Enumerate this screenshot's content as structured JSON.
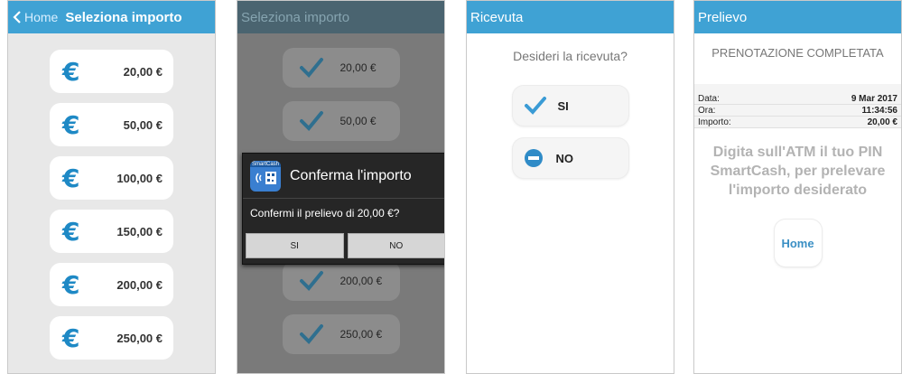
{
  "screen1": {
    "back_label": "Home",
    "title": "Seleziona importo",
    "amounts": [
      "20,00 €",
      "50,00 €",
      "100,00 €",
      "150,00 €",
      "200,00 €",
      "250,00 €"
    ],
    "euro_symbol": "€"
  },
  "screen2": {
    "title": "Seleziona importo",
    "amounts_top": [
      "20,00 €",
      "50,00 €"
    ],
    "amounts_bottom": [
      "200,00 €",
      "250,00 €"
    ],
    "dialog": {
      "app_icon_label": "SmartCash",
      "title": "Conferma l'importo",
      "message": "Confermi il prelievo di 20,00 €?",
      "yes": "SI",
      "no": "NO"
    }
  },
  "screen3": {
    "title": "Ricevuta",
    "question": "Desideri la ricevuta?",
    "yes": "SI",
    "no": "NO"
  },
  "screen4": {
    "title": "Prelievo",
    "status": "PRENOTAZIONE COMPLETATA",
    "rows": [
      {
        "label": "Data:",
        "value": "9 Mar 2017"
      },
      {
        "label": "Ora:",
        "value": "11:34:56"
      },
      {
        "label": "Importo:",
        "value": "20,00 €"
      }
    ],
    "instruction": "Digita sull'ATM il tuo PIN SmartCash, per prelevare l'importo desiderato",
    "home_button": "Home"
  },
  "colors": {
    "accent": "#3fa2d4",
    "euro": "#1e89c5",
    "check": "#3a9bd5"
  }
}
